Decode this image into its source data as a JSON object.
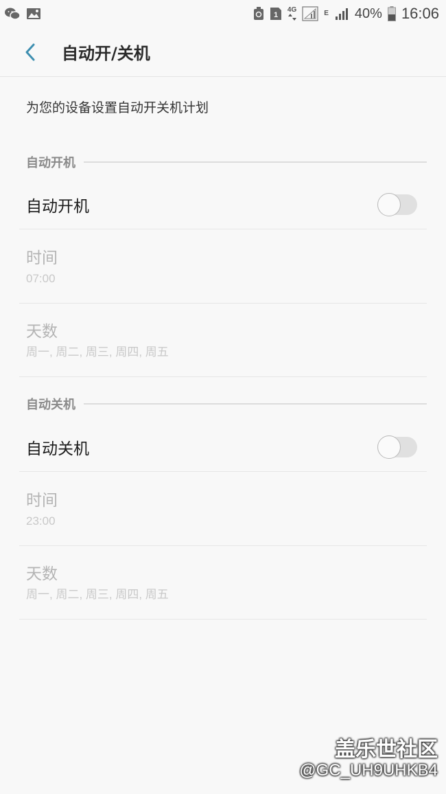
{
  "status_bar": {
    "network_4g": "4G",
    "network_e": "E",
    "battery": "40%",
    "time": "16:06",
    "sim_slot": "1",
    "icons": [
      "wechat-icon",
      "gallery-icon",
      "recycle-icon",
      "sim-card-icon",
      "signal-icon",
      "battery-icon"
    ]
  },
  "app_bar": {
    "title": "自动开/关机",
    "back_icon": "chevron-left-icon",
    "accent_color": "#3e8fb0"
  },
  "description": "为您的设备设置自动开关机计划",
  "sections": [
    {
      "header": "自动开机",
      "toggle": {
        "label": "自动开机",
        "on": false
      },
      "time": {
        "title": "时间",
        "value": "07:00"
      },
      "days": {
        "title": "天数",
        "value": "周一, 周二, 周三, 周四, 周五"
      }
    },
    {
      "header": "自动关机",
      "toggle": {
        "label": "自动关机",
        "on": false
      },
      "time": {
        "title": "时间",
        "value": "23:00"
      },
      "days": {
        "title": "天数",
        "value": "周一, 周二, 周三, 周四, 周五"
      }
    }
  ],
  "watermark": {
    "site": "盖乐世社区",
    "user": "@GC_UH9UHKB4"
  }
}
